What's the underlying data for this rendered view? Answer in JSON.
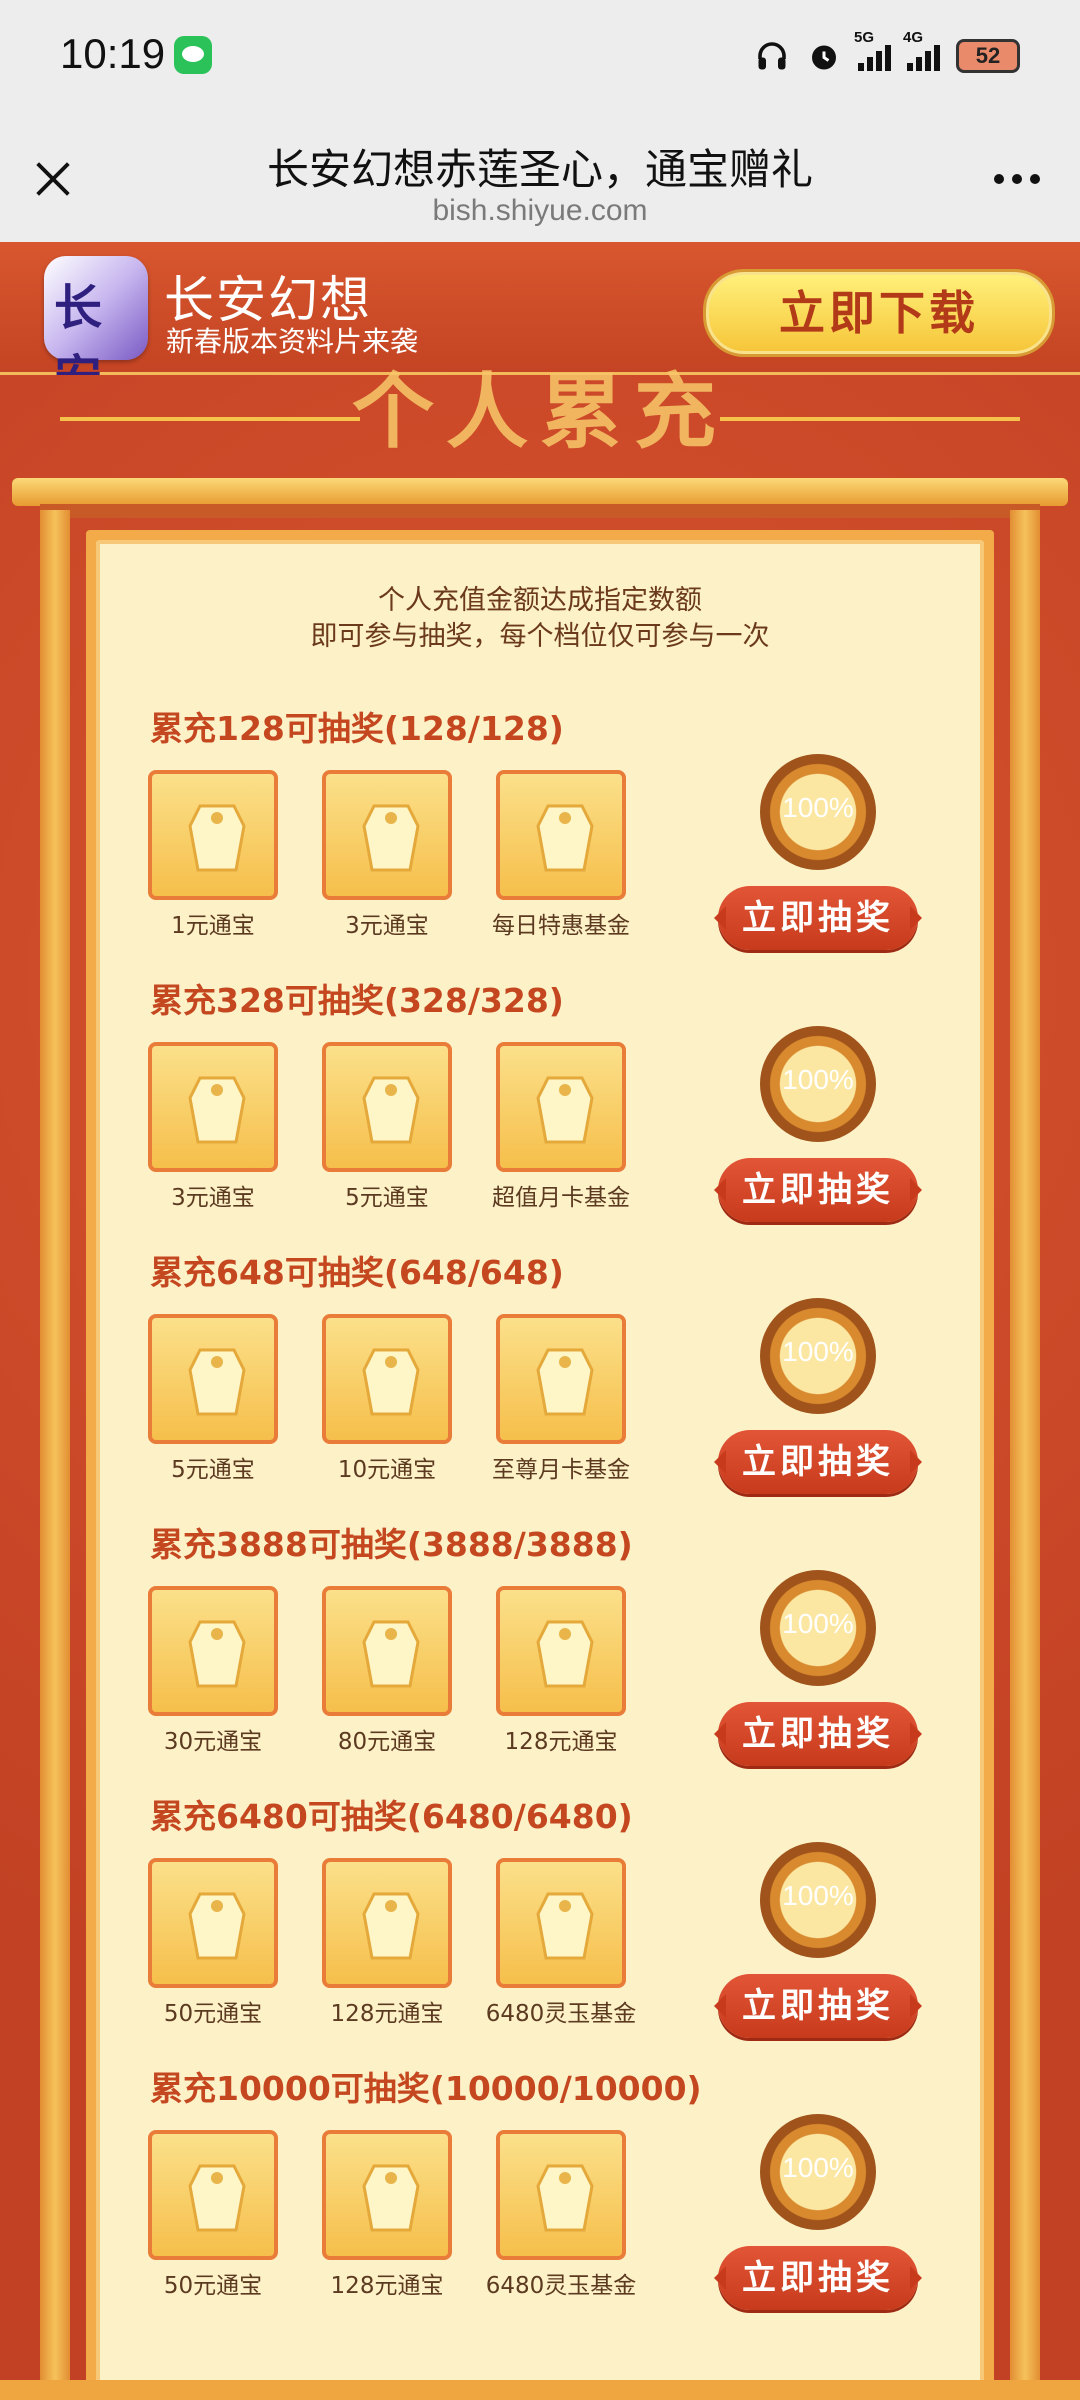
{
  "status_bar": {
    "time": "10:19",
    "net1": "5G",
    "net2": "4G",
    "battery": "52"
  },
  "nav": {
    "title": "长安幻想赤莲圣心，通宝赠礼",
    "url": "bish.shiyue.com"
  },
  "banner": {
    "logo_text": "长安",
    "app_name": "长安幻想",
    "subtitle": "新春版本资料片来袭",
    "download_label": "立即下载"
  },
  "section": {
    "title": "个人累充"
  },
  "intro": {
    "line1": "个人充值金额达成指定数额",
    "line2": "即可参与抽奖，每个档位仅可参与一次"
  },
  "tiers": [
    {
      "title": "累充128可抽奖(128/128)",
      "items": [
        "1元通宝",
        "3元通宝",
        "每日特惠基金"
      ],
      "progress": "100%",
      "button": "立即抽奖"
    },
    {
      "title": "累充328可抽奖(328/328)",
      "items": [
        "3元通宝",
        "5元通宝",
        "超值月卡基金"
      ],
      "progress": "100%",
      "button": "立即抽奖"
    },
    {
      "title": "累充648可抽奖(648/648)",
      "items": [
        "5元通宝",
        "10元通宝",
        "至尊月卡基金"
      ],
      "progress": "100%",
      "button": "立即抽奖"
    },
    {
      "title": "累充3888可抽奖(3888/3888)",
      "items": [
        "30元通宝",
        "80元通宝",
        "128元通宝"
      ],
      "progress": "100%",
      "button": "立即抽奖"
    },
    {
      "title": "累充6480可抽奖(6480/6480)",
      "items": [
        "50元通宝",
        "128元通宝",
        "6480灵玉基金"
      ],
      "progress": "100%",
      "button": "立即抽奖"
    },
    {
      "title": "累充10000可抽奖(10000/10000)",
      "items": [
        "50元通宝",
        "128元通宝",
        "6480灵玉基金"
      ],
      "progress": "100%",
      "button": "立即抽奖"
    }
  ],
  "colors": {
    "accent_red": "#c4471f",
    "panel_bg": "#fdf1c8",
    "gold": "#f6c25a"
  }
}
